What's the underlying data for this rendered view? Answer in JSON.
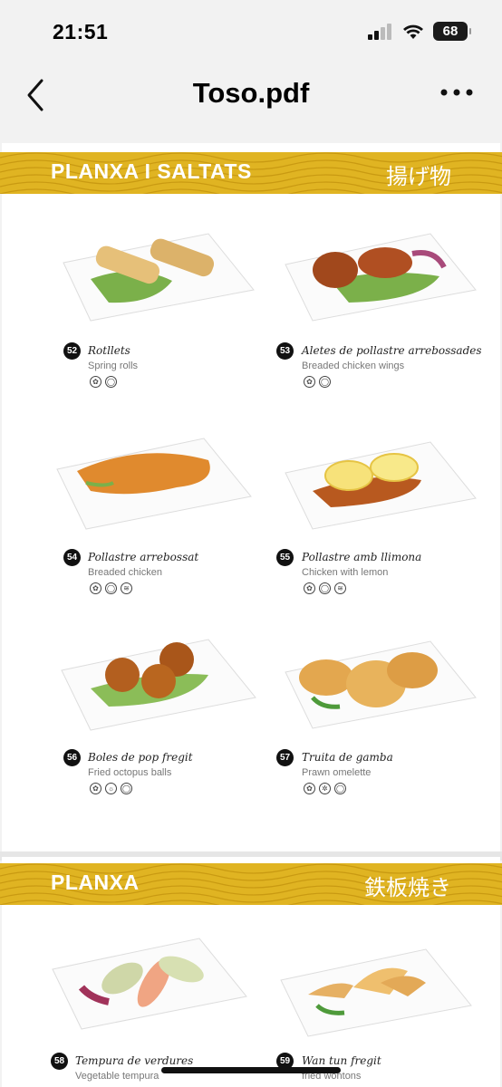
{
  "status": {
    "time": "21:51",
    "battery": "68"
  },
  "nav": {
    "title": "Toso.pdf"
  },
  "colors": {
    "banner": "#e0b422",
    "wave": "#c99a12"
  },
  "sections": [
    {
      "title": "PLANXA I SALTATS",
      "japanese": "揚げ物"
    },
    {
      "title": "PLANXA",
      "japanese": "鉄板焼き"
    }
  ],
  "items": [
    {
      "number": "52",
      "name": "Rotllets",
      "english": "Spring rolls",
      "allergens": [
        "gluten-icon",
        "egg-icon"
      ]
    },
    {
      "number": "53",
      "name": "Aletes de pollastre arrebossades",
      "english": "Breaded chicken wings",
      "allergens": [
        "gluten-icon",
        "egg-icon"
      ]
    },
    {
      "number": "54",
      "name": "Pollastre arrebossat",
      "english": "Breaded chicken",
      "allergens": [
        "gluten-icon",
        "egg-icon",
        "sesame-icon"
      ]
    },
    {
      "number": "55",
      "name": "Pollastre amb llimona",
      "english": "Chicken with lemon",
      "allergens": [
        "gluten-icon",
        "egg-icon",
        "sesame-icon"
      ]
    },
    {
      "number": "56",
      "name": "Boles de pop fregit",
      "english": "Fried octopus balls",
      "allergens": [
        "gluten-icon",
        "mollusc-icon",
        "egg-icon"
      ]
    },
    {
      "number": "57",
      "name": "Truita de gamba",
      "english": "Prawn omelette",
      "allergens": [
        "gluten-icon",
        "crustacean-icon",
        "egg-icon"
      ]
    },
    {
      "number": "58",
      "name": "Tempura de verdures",
      "english": "Vegetable tempura",
      "allergens": []
    },
    {
      "number": "59",
      "name": "Wan tun fregit",
      "english": "fried wontons",
      "allergens": []
    }
  ]
}
